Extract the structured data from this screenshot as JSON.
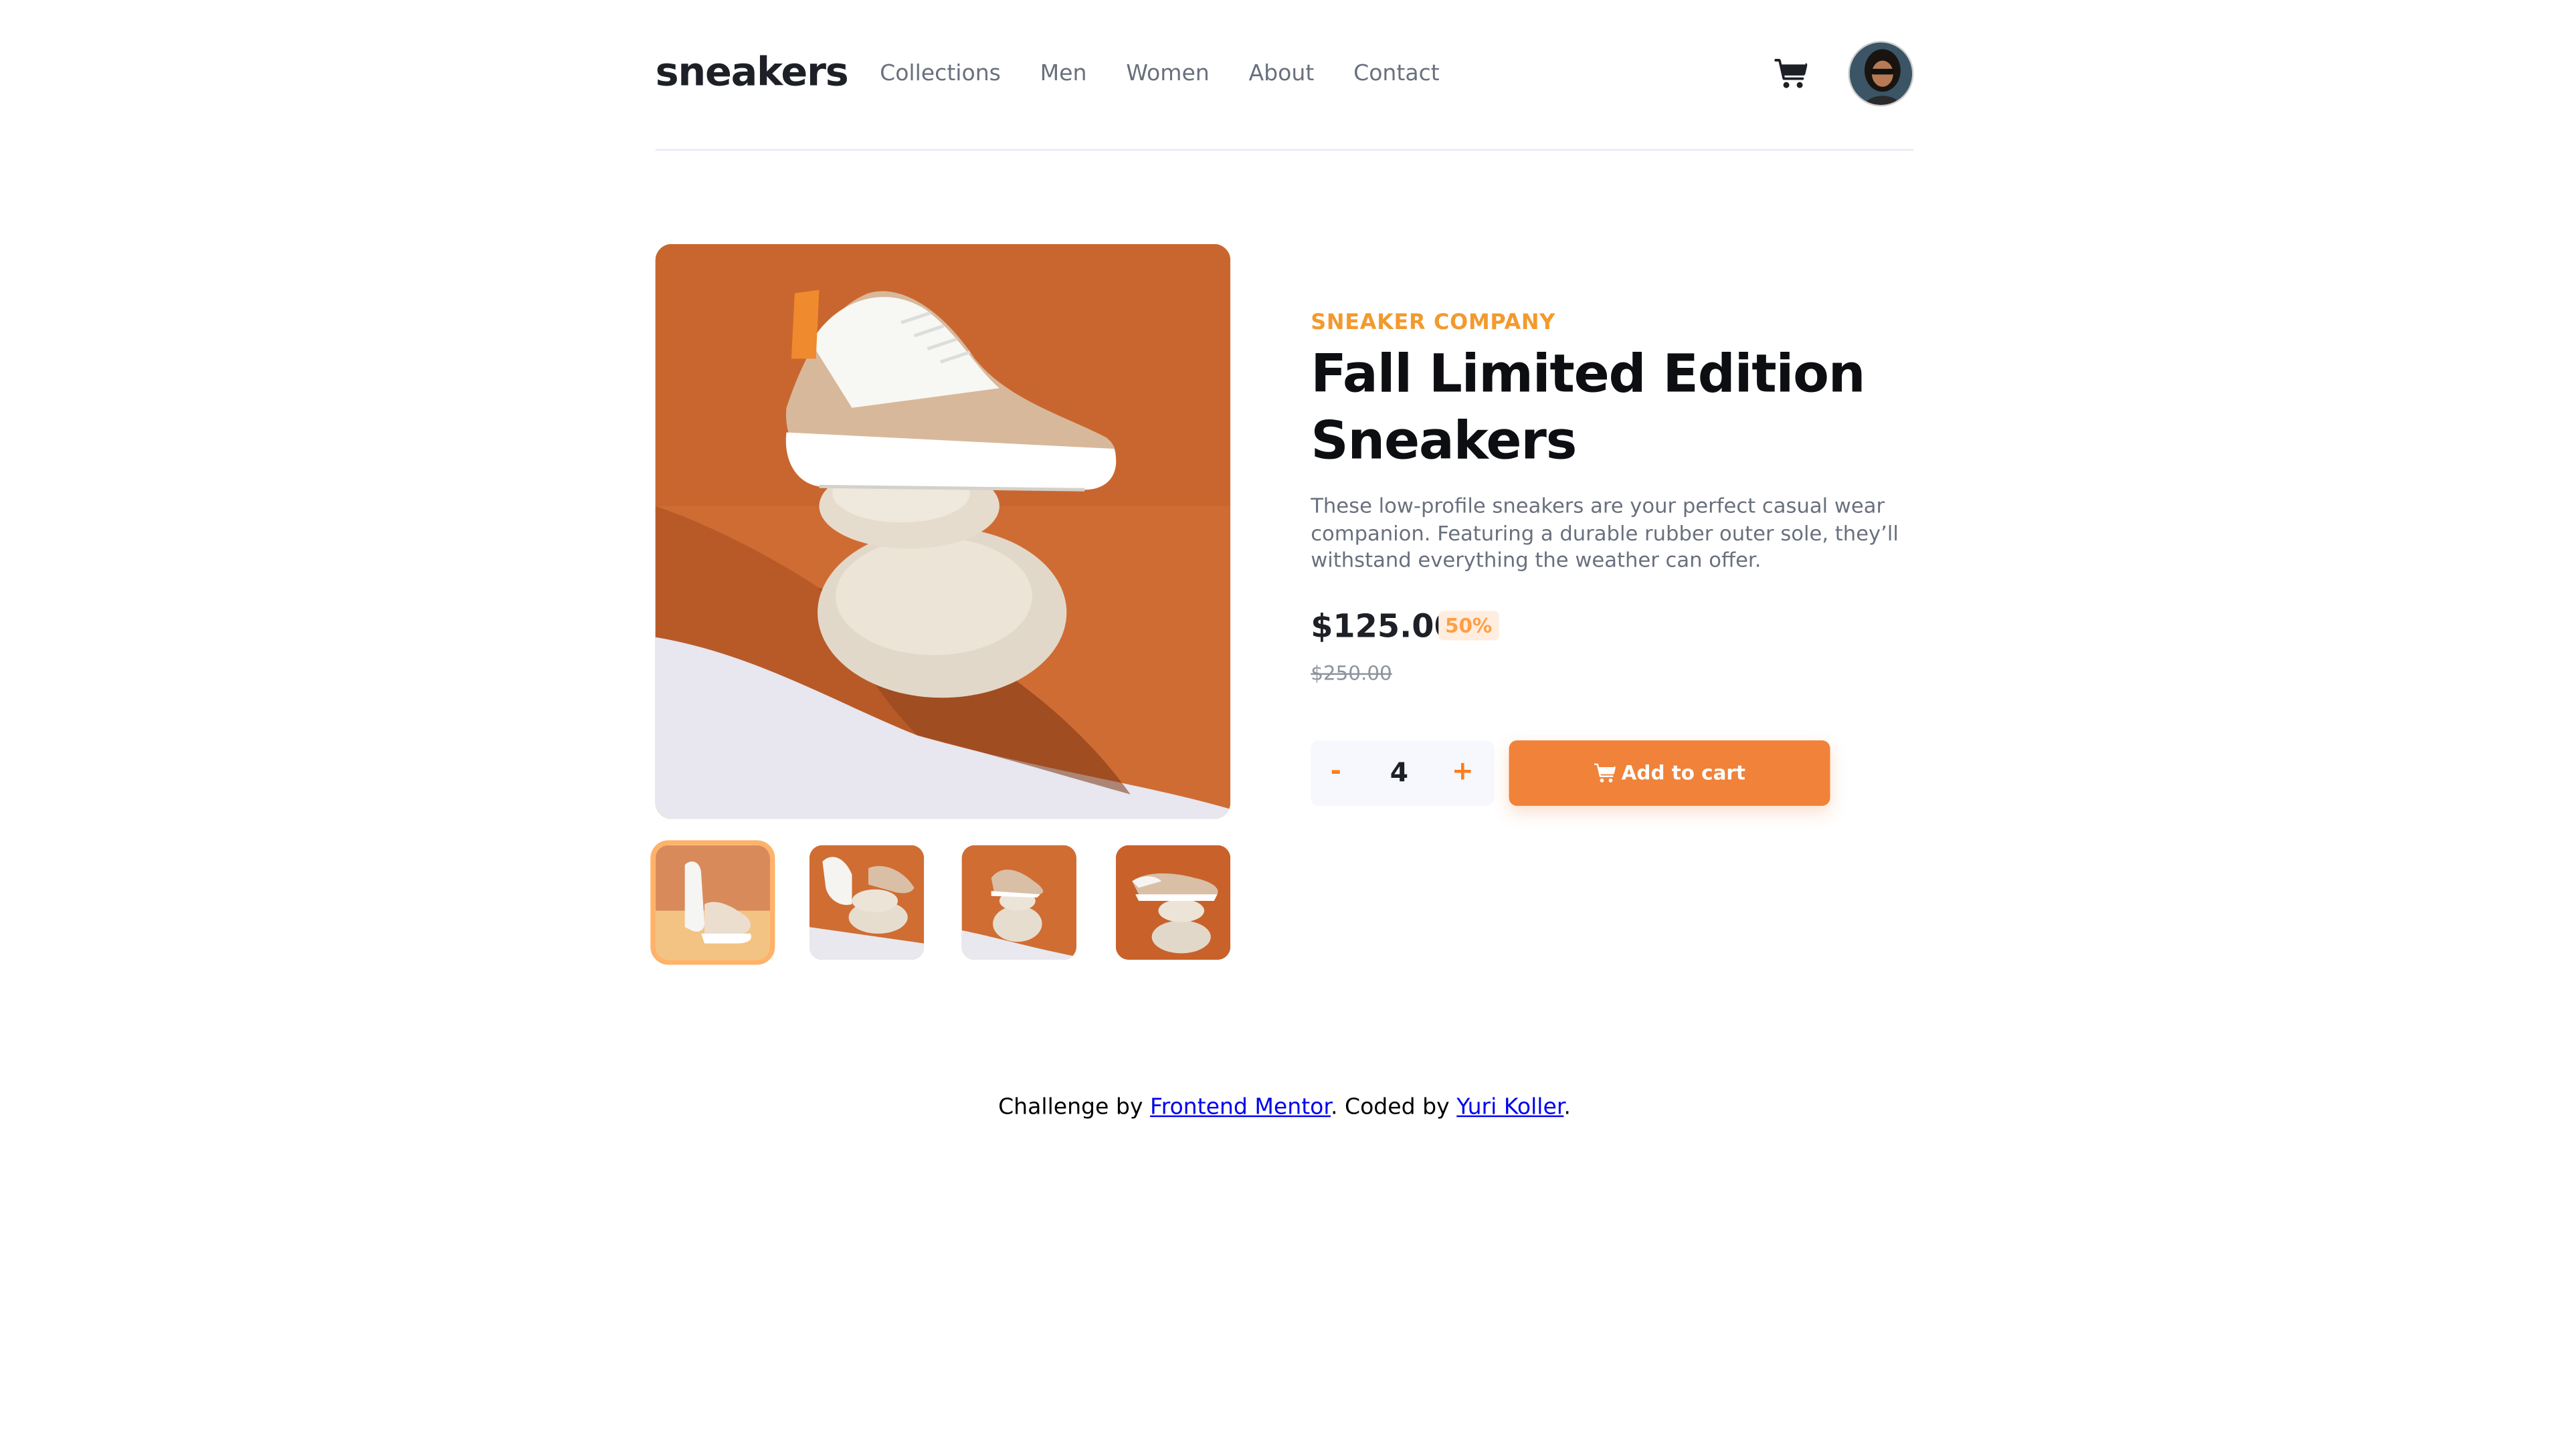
{
  "header": {
    "logo": "sneakers",
    "nav": [
      "Collections",
      "Men",
      "Women",
      "About",
      "Contact"
    ]
  },
  "product": {
    "company": "SNEAKER COMPANY",
    "title": "Fall Limited Edition Sneakers",
    "description": "These low-profile sneakers are your perfect casual wear companion. Featuring a durable rubber outer sole, they’ll withstand everything the weather can offer.",
    "price": "$125.00",
    "discount": "50%",
    "old_price": "$250.00",
    "quantity": "4",
    "qty_minus": "-",
    "qty_plus": "+",
    "add_to_cart": "Add to cart"
  },
  "footer": {
    "prefix": "Challenge by ",
    "link1": "Frontend Mentor",
    "middle": ". Coded by ",
    "link2": "Yuri Koller",
    "suffix": "."
  },
  "colors": {
    "accent": "#f0823a",
    "brand_text": "#f29a2e",
    "product_bg": "#d4692f"
  },
  "icons": [
    "cart-icon",
    "avatar"
  ]
}
